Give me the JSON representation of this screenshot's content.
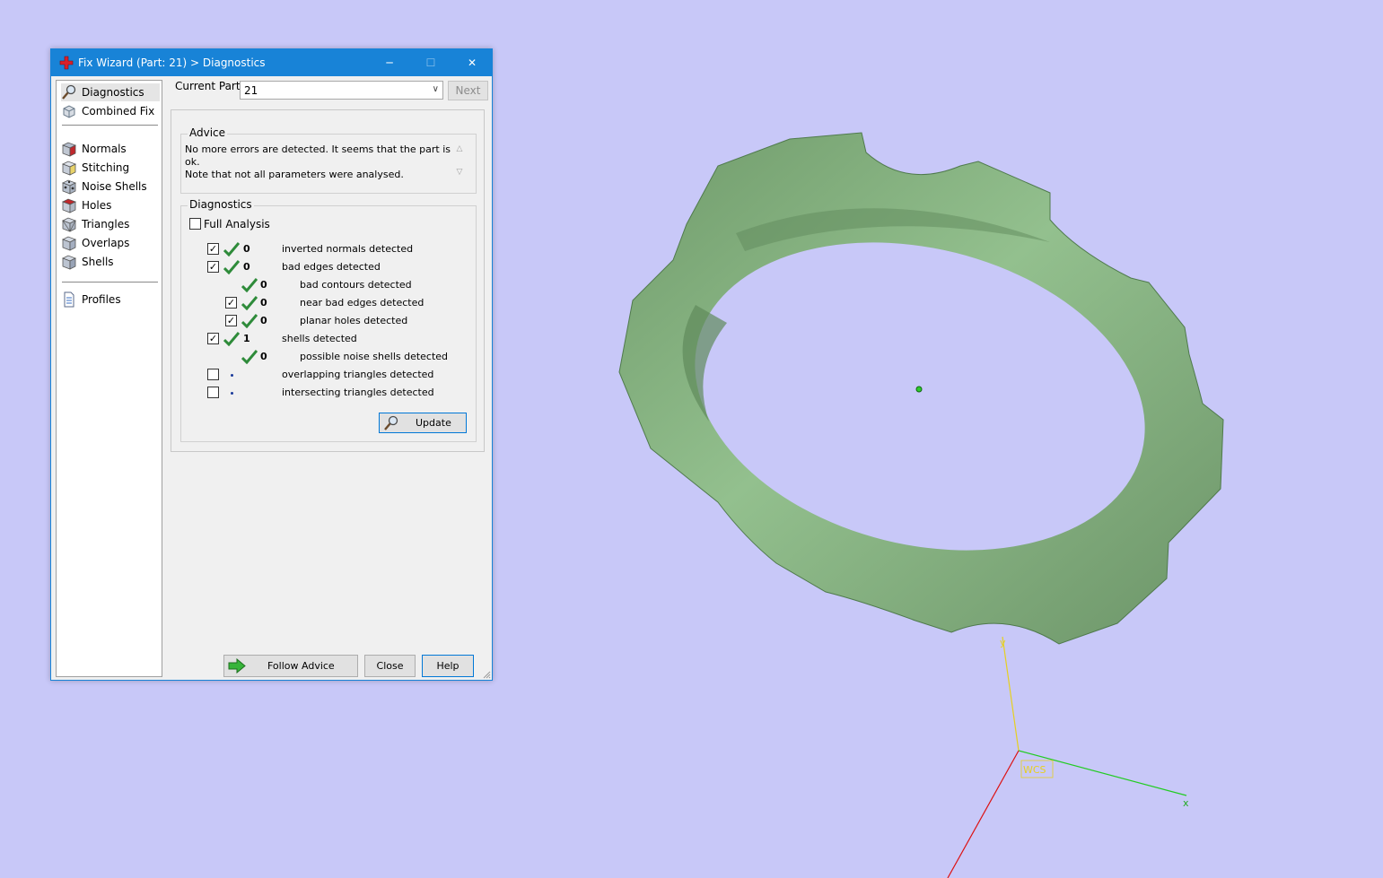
{
  "window": {
    "title": "Fix Wizard (Part: 21) > Diagnostics",
    "controls": {
      "minimize": "─",
      "maximize": "☐",
      "close": "✕"
    }
  },
  "sidebar": {
    "items": [
      {
        "label": "Diagnostics",
        "icon": "magnifier-icon",
        "selected": true
      },
      {
        "label": "Combined Fix",
        "icon": "combined-fix-icon"
      },
      {
        "label": "Normals",
        "icon": "normals-cube-icon"
      },
      {
        "label": "Stitching",
        "icon": "stitching-cube-icon"
      },
      {
        "label": "Noise Shells",
        "icon": "noise-shells-icon"
      },
      {
        "label": "Holes",
        "icon": "holes-cube-icon"
      },
      {
        "label": "Triangles",
        "icon": "triangles-cube-icon"
      },
      {
        "label": "Overlaps",
        "icon": "overlaps-cube-icon"
      },
      {
        "label": "Shells",
        "icon": "shells-cube-icon"
      },
      {
        "label": "Profiles",
        "icon": "document-icon"
      }
    ]
  },
  "current_part": {
    "label": "Current Part:",
    "value": "21",
    "next_label": "Next"
  },
  "advice": {
    "legend": "Advice",
    "line1": "No more errors are detected. It seems that the part is ok.",
    "line2": "Note that not all parameters were analysed."
  },
  "diagnostics": {
    "legend": "Diagnostics",
    "full_analysis": {
      "label": "Full Analysis",
      "checked": false
    },
    "rows": [
      {
        "checkbox": true,
        "checked": true,
        "status": "ok",
        "count": "0",
        "label": "inverted normals detected"
      },
      {
        "checkbox": true,
        "checked": true,
        "status": "ok",
        "count": "0",
        "label": "bad edges detected"
      },
      {
        "checkbox": false,
        "status": "ok",
        "count": "0",
        "label": "bad contours detected"
      },
      {
        "checkbox": true,
        "checked": true,
        "status": "ok",
        "count": "0",
        "label": "near bad edges detected"
      },
      {
        "checkbox": true,
        "checked": true,
        "status": "ok",
        "count": "0",
        "label": "planar holes detected"
      },
      {
        "checkbox": true,
        "checked": true,
        "status": "ok",
        "count": "1",
        "label": "shells detected"
      },
      {
        "checkbox": false,
        "status": "ok",
        "count": "0",
        "label": "possible noise shells detected"
      },
      {
        "checkbox": true,
        "checked": false,
        "status": "pending",
        "count": "",
        "label": "overlapping triangles detected"
      },
      {
        "checkbox": true,
        "checked": false,
        "status": "pending",
        "count": "",
        "label": "intersecting triangles detected"
      }
    ],
    "update_label": "Update"
  },
  "footer": {
    "follow_advice_label": "Follow Advice",
    "close_label": "Close",
    "help_label": "Help"
  },
  "viewport": {
    "axis_y_label": "y",
    "axis_x_label": "x",
    "wcs_label": "WCS",
    "colors": {
      "background": "#c8c8f8",
      "model": "#8fb88a",
      "axis_x": "#22cc22",
      "axis_y": "#e6d020",
      "axis_z": "#dd1111"
    }
  },
  "colors": {
    "accent": "#1883d7",
    "ok_check": "#2e8b3a"
  }
}
